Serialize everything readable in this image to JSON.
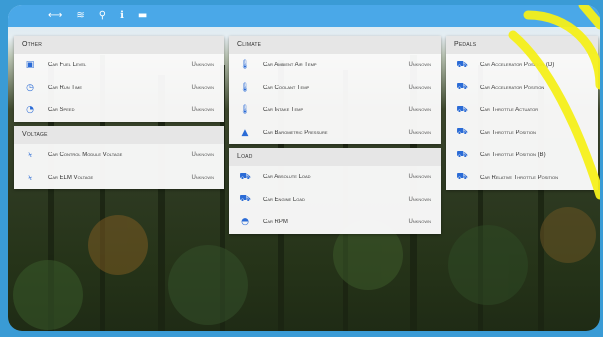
{
  "status_icons": [
    "⟷",
    "≋",
    "⚲",
    "ℹ",
    "▬"
  ],
  "panels": {
    "other": {
      "title": "Other",
      "rows": [
        {
          "icon": "fuel-icon",
          "glyph": "▣",
          "label": "Car Fuel Level",
          "value": "Unknown"
        },
        {
          "icon": "timer-icon",
          "glyph": "◷",
          "label": "Car Run Time",
          "value": "Unknown"
        },
        {
          "icon": "speedometer-icon",
          "glyph": "◔",
          "label": "Car Speed",
          "value": "Unknown"
        }
      ]
    },
    "voltage": {
      "title": "Voltage",
      "rows": [
        {
          "icon": "bolt-icon",
          "glyph": "ϟ",
          "label": "Car Control Module Voltage",
          "value": "Unknown"
        },
        {
          "icon": "bolt-icon",
          "glyph": "ϟ",
          "label": "Car ELM Voltage",
          "value": "Unknown"
        }
      ]
    },
    "climate": {
      "title": "Climate",
      "rows": [
        {
          "icon": "thermometer-icon",
          "glyph": "🌡",
          "label": "Car Ambient Air Temp",
          "value": "Unknown"
        },
        {
          "icon": "thermometer-icon",
          "glyph": "🌡",
          "label": "Car Coolant Temp",
          "value": "Unknown"
        },
        {
          "icon": "thermometer-icon",
          "glyph": "🌡",
          "label": "Car Intake Temp",
          "value": "Unknown"
        },
        {
          "icon": "barometer-icon",
          "glyph": "▲",
          "label": "Car Barometric Pressure",
          "value": "Unknown"
        }
      ]
    },
    "load": {
      "title": "Load",
      "rows": [
        {
          "icon": "truck-icon",
          "glyph": "⛟",
          "label": "Car Absolute Load",
          "value": "Unknown"
        },
        {
          "icon": "truck-icon",
          "glyph": "⛟",
          "label": "Car Engine Load",
          "value": "Unknown"
        },
        {
          "icon": "gauge-icon",
          "glyph": "◓",
          "label": "Car RPM",
          "value": "Unknown"
        }
      ]
    },
    "pedals": {
      "title": "Pedals",
      "rows": [
        {
          "icon": "truck-icon",
          "glyph": "⛟",
          "label": "Car Accelerator Position (D)",
          "value": ""
        },
        {
          "icon": "truck-icon",
          "glyph": "⛟",
          "label": "Car Accelerator Position",
          "value": ""
        },
        {
          "icon": "truck-icon",
          "glyph": "⛟",
          "label": "Car Throttle Actuator",
          "value": ""
        },
        {
          "icon": "truck-icon",
          "glyph": "⛟",
          "label": "Car Throttle Position",
          "value": ""
        },
        {
          "icon": "truck-icon",
          "glyph": "⛟",
          "label": "Car Throttle Position (B)",
          "value": ""
        },
        {
          "icon": "truck-icon",
          "glyph": "⛟",
          "label": "Car Relative Throttle Position",
          "value": ""
        }
      ]
    }
  },
  "colors": {
    "accent": "#2a6bd6",
    "highlight": "#f5f01a",
    "statusbar": "#4aa8e8"
  }
}
